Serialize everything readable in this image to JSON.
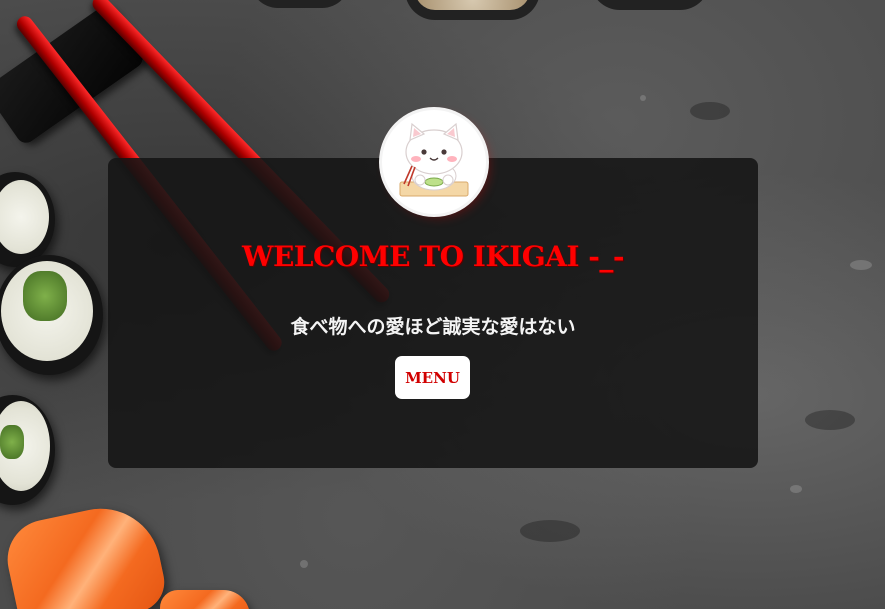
{
  "hero": {
    "title": "WELCOME TO IKIGAI -_-",
    "subtitle": "食べ物への愛ほど誠実な愛はない",
    "menu_button": "MENU"
  },
  "icons": {
    "avatar": "cat-eating-icon"
  },
  "colors": {
    "title": "#ff0000",
    "button_text": "#d10000",
    "button_bg": "#ffffff",
    "card_bg": "rgba(20,20,20,0.88)"
  }
}
